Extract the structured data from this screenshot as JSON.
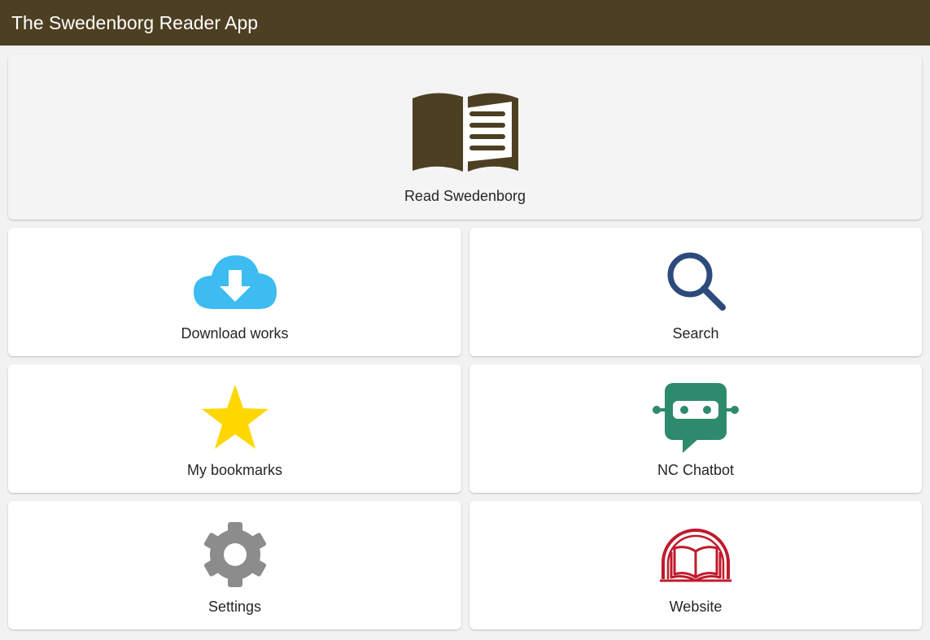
{
  "app": {
    "title": "The Swedenborg Reader App",
    "colors": {
      "titlebar": "#4d3f22",
      "book": "#4d3f22",
      "download": "#3cbcf0",
      "search": "#2d4a7c",
      "star": "#ffd700",
      "chatbot": "#2e8a6c",
      "settings": "#8c8c8c",
      "website": "#c01a2c"
    }
  },
  "menu": {
    "read": {
      "label": "Read Swedenborg",
      "icon": "open-book-icon"
    },
    "download": {
      "label": "Download works",
      "icon": "cloud-download-icon"
    },
    "search": {
      "label": "Search",
      "icon": "magnifier-icon"
    },
    "bookmarks": {
      "label": "My bookmarks",
      "icon": "star-icon"
    },
    "chatbot": {
      "label": "NC Chatbot",
      "icon": "chatbot-icon"
    },
    "settings": {
      "label": "Settings",
      "icon": "gear-icon"
    },
    "website": {
      "label": "Website",
      "icon": "website-book-icon"
    }
  }
}
